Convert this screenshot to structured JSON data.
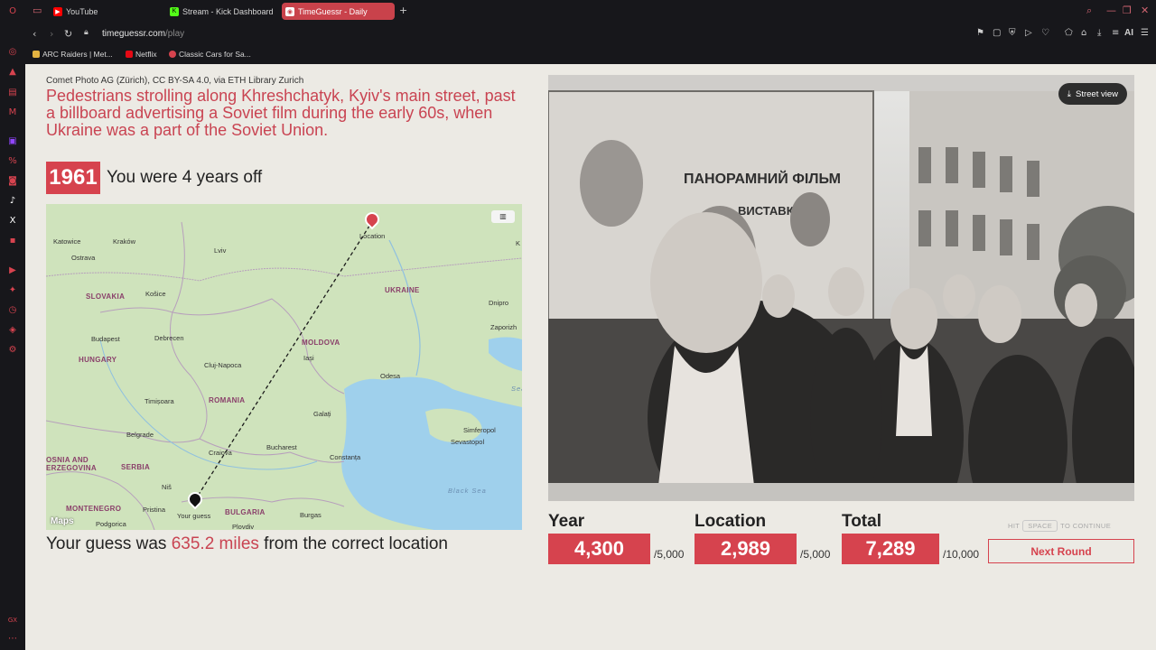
{
  "tabs": [
    {
      "title": "YouTube",
      "icon": "youtube-icon",
      "color": "#ff0000"
    },
    {
      "title": "Stream - Kick Dashboard",
      "icon": "kick-icon",
      "color": "#53fc18"
    },
    {
      "title": "TimeGuessr - Daily",
      "icon": "timeguessr-icon",
      "color": "#c9424b"
    }
  ],
  "address": {
    "domain": "timeguessr.com",
    "path": "/play"
  },
  "bookmarks": [
    "ARC Raiders | Met...",
    "Netflix",
    "Classic Cars for Sa..."
  ],
  "toolbar": {
    "ai_label": "AI"
  },
  "result": {
    "credit": "Comet Photo AG (Zürich), CC BY-SA 4.0, via ETH Library Zurich",
    "headline": "Pedestrians strolling along Khreshchatyk, Kyiv's main street, past a billboard advertising a Soviet film during the early 60s, when Ukraine was a part of the Soviet Union.",
    "year": "1961",
    "years_off_text": "You were 4 years off",
    "distance_prefix": "Your guess was ",
    "distance_value": "635.2 miles",
    "distance_suffix": " from the correct location"
  },
  "map": {
    "brand": "Maps",
    "labels": {
      "katowice": "Katowice",
      "krakow": "Kraków",
      "lviv": "Lviv",
      "ostrava": "Ostrava",
      "slovakia": "SLOVAKIA",
      "kosice": "Košice",
      "ukraine": "UKRAINE",
      "dnipro": "Dnipro",
      "zaporizh": "Zaporizh",
      "budapest": "Budapest",
      "debrecen": "Debrecen",
      "moldova": "MOLDOVA",
      "hungary": "HUNGARY",
      "iasi": "Iași",
      "cluj": "Cluj-Napoca",
      "odesa": "Odesa",
      "romania": "ROMANIA",
      "timisoara": "Timișoara",
      "galati": "Galați",
      "simferopol": "Simferopol",
      "belgrade": "Belgrade",
      "sevastopol": "Sevastopol",
      "craiova": "Craiova",
      "bucharest": "Bucharest",
      "bosnia1": "OSNIA AND",
      "bosnia2": "ERZEGOVINA",
      "serbia": "SERBIA",
      "constanta": "Constanța",
      "nis": "Niš",
      "black_sea": "Black Sea",
      "montenegro": "MONTENEGRO",
      "pristina": "Pristina",
      "bulgaria": "BULGARIA",
      "podgorica": "Podgorica",
      "plovdiv": "Plovdiv",
      "burgas": "Burgas",
      "location": "Location",
      "your_guess": "Your guess",
      "azov": "Sea of",
      "k": "K"
    }
  },
  "photo": {
    "street_view_label": "Street view",
    "billboard_text_1": "ПАНОРАМНИЙ ФІЛЬМ",
    "billboard_text_2": "ВИСТАВКА"
  },
  "scores": {
    "year": {
      "label": "Year",
      "value": "4,300",
      "max": "/5,000"
    },
    "location": {
      "label": "Location",
      "value": "2,989",
      "max": "/5,000"
    },
    "total": {
      "label": "Total",
      "value": "7,289",
      "max": "/10,000"
    }
  },
  "continue_hint": {
    "hit": "HIT",
    "key": "SPACE",
    "to_continue": "TO CONTINUE"
  },
  "next_round_label": "Next Round",
  "colors": {
    "accent": "#d6434e",
    "page_bg": "#eceae4"
  }
}
